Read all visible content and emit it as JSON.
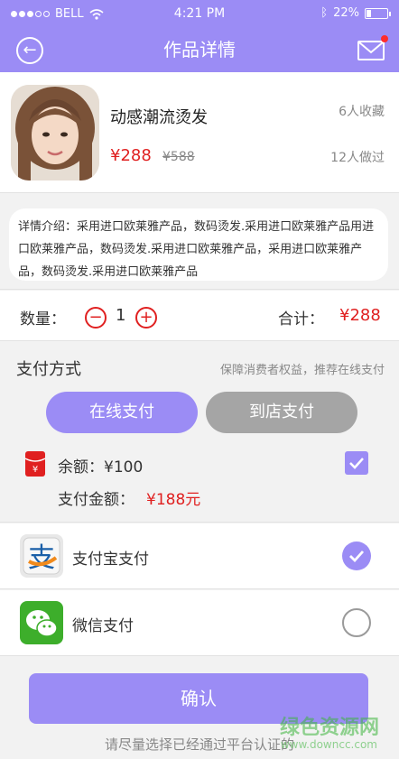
{
  "status_bar": {
    "carrier": "BELL",
    "time": "4:21 PM",
    "battery": "22%",
    "battery_level": 0.22
  },
  "header": {
    "title": "作品详情",
    "back_icon": "back-arrow-icon",
    "mail_icon": "mail-icon"
  },
  "product": {
    "name": "动感潮流烫发",
    "favorites": "6人收藏",
    "price": "¥288",
    "original_price": "¥588",
    "done_count": "12人做过"
  },
  "description": "详情介绍：采用进口欧莱雅产品，数码烫发.采用进口欧莱雅产品用进口欧莱雅产品，数码烫发.采用进口欧莱雅产品，采用进口欧莱雅产品，数码烫发.采用进口欧莱雅产品",
  "quantity": {
    "label": "数量：",
    "value": "1",
    "total_label": "合计：",
    "total": "¥288"
  },
  "payment": {
    "title": "支付方式",
    "hint": "保障消费者权益，推荐在线支付",
    "online_label": "在线支付",
    "store_label": "到店支付",
    "balance": "余额：¥100",
    "amount_label": "支付金额：",
    "amount_value": "¥188元",
    "use_balance_checked": true
  },
  "methods": [
    {
      "label": "支付宝支付",
      "icon": "alipay-icon",
      "selected": true
    },
    {
      "label": "微信支付",
      "icon": "wechat-icon",
      "selected": false
    }
  ],
  "confirm_label": "确认",
  "notice": "请尽量选择已经通过平台认证的",
  "watermark": {
    "text": "绿色资源网",
    "url_text": "www.downcc.com"
  },
  "colors": {
    "accent": "#9b8cf5",
    "price_red": "#e02020",
    "inactive_gray": "#a5a5a5"
  }
}
